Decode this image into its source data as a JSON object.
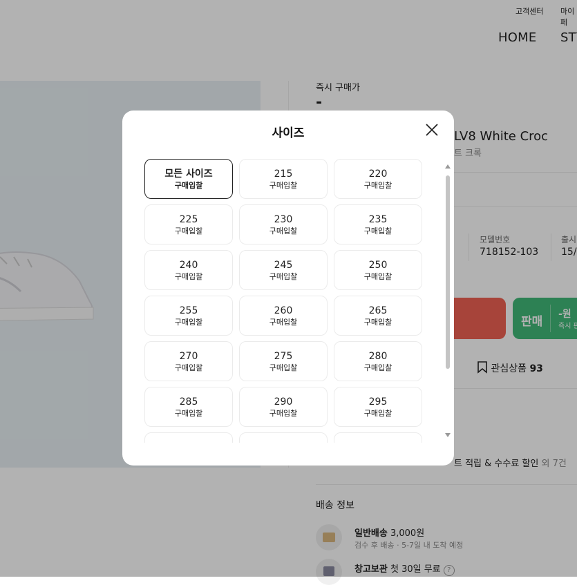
{
  "topbar": {
    "customer_center": "고객센터",
    "mypage": "마이페"
  },
  "nav": {
    "home": "HOME",
    "style": "STY"
  },
  "product": {
    "instant_price_label": "즉시 구매가",
    "instant_price_value": "-",
    "name_en_partial": "LV8 White Croc",
    "name_ko_partial": "트 크록",
    "model_label": "모델번호",
    "model_value": "718152-103",
    "release_label": "출시",
    "release_value_partial": "15/0"
  },
  "actions": {
    "sell_label": "판매",
    "sell_price": "-원",
    "sell_sub": "즉시 판",
    "wish_label": "관심상품",
    "wish_count": "93"
  },
  "benefits": {
    "text": "트 적립 & 수수료 할인",
    "extra": "외 7건"
  },
  "delivery": {
    "title": "배송 정보",
    "normal_label": "일반배송",
    "normal_price": "3,000원",
    "normal_sub": "검수 후 배송 · 5-7일 내 도착 예정",
    "storage_label": "창고보관",
    "storage_sub": "첫 30일 무료"
  },
  "modal": {
    "title": "사이즈",
    "sizes": [
      {
        "size": "모든 사이즈",
        "status": "구매입찰",
        "selected": true
      },
      {
        "size": "215",
        "status": "구매입찰"
      },
      {
        "size": "220",
        "status": "구매입찰"
      },
      {
        "size": "225",
        "status": "구매입찰"
      },
      {
        "size": "230",
        "status": "구매입찰"
      },
      {
        "size": "235",
        "status": "구매입찰"
      },
      {
        "size": "240",
        "status": "구매입찰"
      },
      {
        "size": "245",
        "status": "구매입찰"
      },
      {
        "size": "250",
        "status": "구매입찰"
      },
      {
        "size": "255",
        "status": "구매입찰"
      },
      {
        "size": "260",
        "status": "구매입찰"
      },
      {
        "size": "265",
        "status": "구매입찰"
      },
      {
        "size": "270",
        "status": "구매입찰"
      },
      {
        "size": "275",
        "status": "구매입찰"
      },
      {
        "size": "280",
        "status": "구매입찰"
      },
      {
        "size": "285",
        "status": "구매입찰"
      },
      {
        "size": "290",
        "status": "구매입찰"
      },
      {
        "size": "295",
        "status": "구매입찰"
      }
    ]
  },
  "colors": {
    "buy": "#ef6253",
    "sell": "#41b979",
    "hero_bg": "#e8f0f4"
  }
}
